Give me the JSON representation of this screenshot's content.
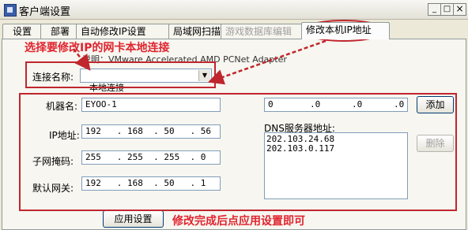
{
  "window": {
    "title": "客户端设置",
    "min": "_",
    "max": "□",
    "close": "×"
  },
  "tabs": [
    {
      "label": "设置",
      "state": "normal"
    },
    {
      "label": "部署",
      "state": "normal"
    },
    {
      "label": "自动修改IP设置",
      "state": "normal"
    },
    {
      "label": "局域网扫描",
      "state": "normal"
    },
    {
      "label": "游戏数据库编辑",
      "state": "disabled"
    },
    {
      "label": "修改本机IP地址",
      "state": "active"
    }
  ],
  "annotations": {
    "select_nic": "选择要修改IP的网卡本地连接",
    "apply_hint": "修改完成后点应用设置即可"
  },
  "adapter": {
    "description": "说明：VMware Accelerated AMD PCNet Adapter",
    "connection_label": "连接名称:",
    "connection_value": "本地连接"
  },
  "form": {
    "machine_name_label": "机器名:",
    "machine_name_value": "EYOO-1",
    "ip_label": "IP地址:",
    "ip_value": "192   . 168  . 50   . 56",
    "mask_label": "子网掩码:",
    "mask_value": "255   . 255  . 255  . 0",
    "gateway_label": "默认网关:",
    "gateway_value": "192   . 168  . 50   . 1"
  },
  "dns": {
    "input_value": "0       .0      .0      .0",
    "add_button": "添加",
    "label": "DNS服务器地址:",
    "servers": [
      "202.103.24.68",
      "202.103.0.117"
    ],
    "delete_button": "删除"
  },
  "apply_button": "应用设置",
  "colors": {
    "annotation": "#e0242f",
    "box": "#c0262e"
  }
}
